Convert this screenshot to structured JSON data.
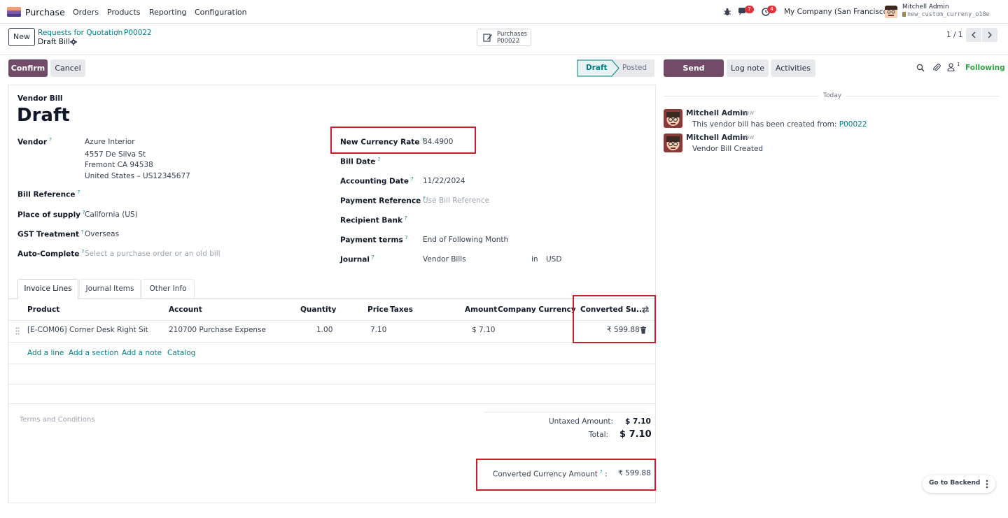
{
  "nav": {
    "app_name": "Purchase",
    "menu": [
      "Orders",
      "Products",
      "Reporting",
      "Configuration"
    ],
    "chat_count": "7",
    "activity_count": "4",
    "company": "My Company (San Francisco)",
    "user_name": "Mitchell Admin",
    "db_name": "new_custom_curreny_o18e"
  },
  "control": {
    "new_label": "New",
    "breadcrumb_parent": "Requests for Quotation",
    "breadcrumb_sep": "/",
    "breadcrumb_record": "P00022",
    "current": "Draft Bill",
    "smart_button_title": "Purchases",
    "smart_button_value": "P00022",
    "pager": "1 / 1"
  },
  "actions": {
    "confirm": "Confirm",
    "cancel": "Cancel",
    "status_draft": "Draft",
    "status_posted": "Posted"
  },
  "chatter": {
    "send_message": "Send message",
    "log_note": "Log note",
    "activities": "Activities",
    "followers_count": "1",
    "following": "Following",
    "date_sep": "Today",
    "messages": [
      {
        "author": "Mitchell Admin",
        "time": "- now",
        "text": "This vendor bill has been created from:",
        "link": "P00022"
      },
      {
        "author": "Mitchell Admin",
        "time": "- now",
        "text": "Vendor Bill Created",
        "link": ""
      }
    ]
  },
  "form": {
    "doc_type": "Vendor Bill",
    "state_title": "Draft",
    "vendor_label": "Vendor",
    "vendor_name": "Azure Interior",
    "vendor_address_1": "4557 De Silva St",
    "vendor_address_2": "Fremont CA 94538",
    "vendor_address_3": "United States – US12345677",
    "bill_reference_label": "Bill Reference",
    "place_of_supply_label": "Place of supply",
    "place_of_supply": "California (US)",
    "gst_treatment_label": "GST Treatment",
    "gst_treatment": "Overseas",
    "auto_complete_label": "Auto-Complete",
    "auto_complete_placeholder": "Select a purchase order or an old bill",
    "currency_rate_label": "New Currency Rate",
    "currency_rate": "84.4900",
    "bill_date_label": "Bill Date",
    "accounting_date_label": "Accounting Date",
    "accounting_date": "11/22/2024",
    "payment_reference_label": "Payment Reference",
    "payment_reference_placeholder": "Use Bill Reference",
    "recipient_bank_label": "Recipient Bank",
    "payment_terms_label": "Payment terms",
    "payment_terms": "End of Following Month",
    "journal_label": "Journal",
    "journal": "Vendor Bills",
    "journal_in": "in",
    "journal_currency": "USD"
  },
  "tabs": [
    "Invoice Lines",
    "Journal Items",
    "Other Info"
  ],
  "lines": {
    "headers": {
      "product": "Product",
      "account": "Account",
      "quantity": "Quantity",
      "price": "Price",
      "taxes": "Taxes",
      "amount": "Amount",
      "company_currency": "Company Currency",
      "converted": "Converted Su..."
    },
    "rows": [
      {
        "product": "[E-COM06] Corner Desk Right Sit",
        "account": "210700 Purchase Expense",
        "quantity": "1.00",
        "price": "7.10",
        "taxes": "",
        "amount": "$ 7.10",
        "company_currency": "",
        "converted": "₹ 599.88"
      }
    ],
    "add_line": "Add a line",
    "add_section": "Add a section",
    "add_note": "Add a note",
    "catalog": "Catalog"
  },
  "totals": {
    "terms_placeholder": "Terms and Conditions",
    "untaxed_label": "Untaxed Amount:",
    "untaxed_value": "$ 7.10",
    "total_label": "Total:",
    "total_value": "$ 7.10",
    "converted_label": "Converted Currency Amount",
    "converted_colon": ":",
    "converted_value": "₹ 599.88"
  },
  "floating": {
    "go_backend": "Go to Backend"
  }
}
